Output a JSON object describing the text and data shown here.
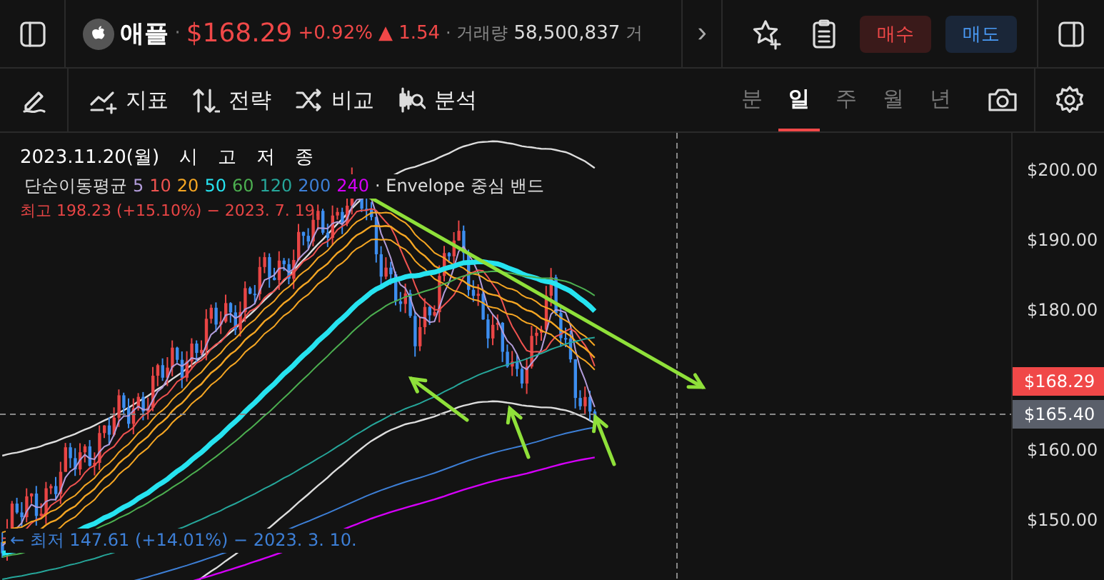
{
  "header": {
    "name": "애플",
    "price": "$168.29",
    "change_pct": "+0.92%",
    "change_arrow": "▲",
    "change": "1.54",
    "separator": "·",
    "volume_label": "· 거래량",
    "volume": "58,500,837",
    "cut_text": "거",
    "more": "›"
  },
  "orders": [
    {
      "label": "매수",
      "kind": "buy"
    },
    {
      "label": "매도",
      "kind": "sell"
    }
  ],
  "toolbar": {
    "tools": [
      {
        "label": "지표",
        "kind": "indicator"
      },
      {
        "label": "전략",
        "kind": "strategy"
      },
      {
        "label": "비교",
        "kind": "compare"
      },
      {
        "label": "분석",
        "kind": "analysis"
      }
    ],
    "periods": [
      {
        "label": "분",
        "selected": false
      },
      {
        "label": "일",
        "selected": true
      },
      {
        "label": "주",
        "selected": false
      },
      {
        "label": "월",
        "selected": false
      },
      {
        "label": "년",
        "selected": false
      }
    ]
  },
  "chart": {
    "date": "2023.11.20(월)",
    "ohlc": [
      "시",
      "고",
      "저",
      "종"
    ],
    "high_marker": "최고 198.23 (+15.10%) − 2023. 7. 19.",
    "legend_title": "단순이동평균",
    "ma": [
      {
        "label": "5",
        "color": "#b39ddb"
      },
      {
        "label": "10",
        "color": "#ef5350"
      },
      {
        "label": "20",
        "color": "#f5a623"
      },
      {
        "label": "50",
        "color": "#26e3f0"
      },
      {
        "label": "60",
        "color": "#4caf50"
      },
      {
        "label": "120",
        "color": "#26a69a"
      },
      {
        "label": "200",
        "color": "#3d7fd6"
      },
      {
        "label": "240",
        "color": "#d500f9"
      }
    ],
    "envelope": "· Envelope 중심 밴드",
    "low_marker": "← 최저 147.61 (+14.01%) − 2023. 3. 10."
  },
  "price_axis": {
    "ticks": [
      "$200.00",
      "$190.00",
      "$180.00",
      "$160.00",
      "$150.00"
    ],
    "last_price": "$168.29",
    "cross_price": "$165.40"
  }
}
